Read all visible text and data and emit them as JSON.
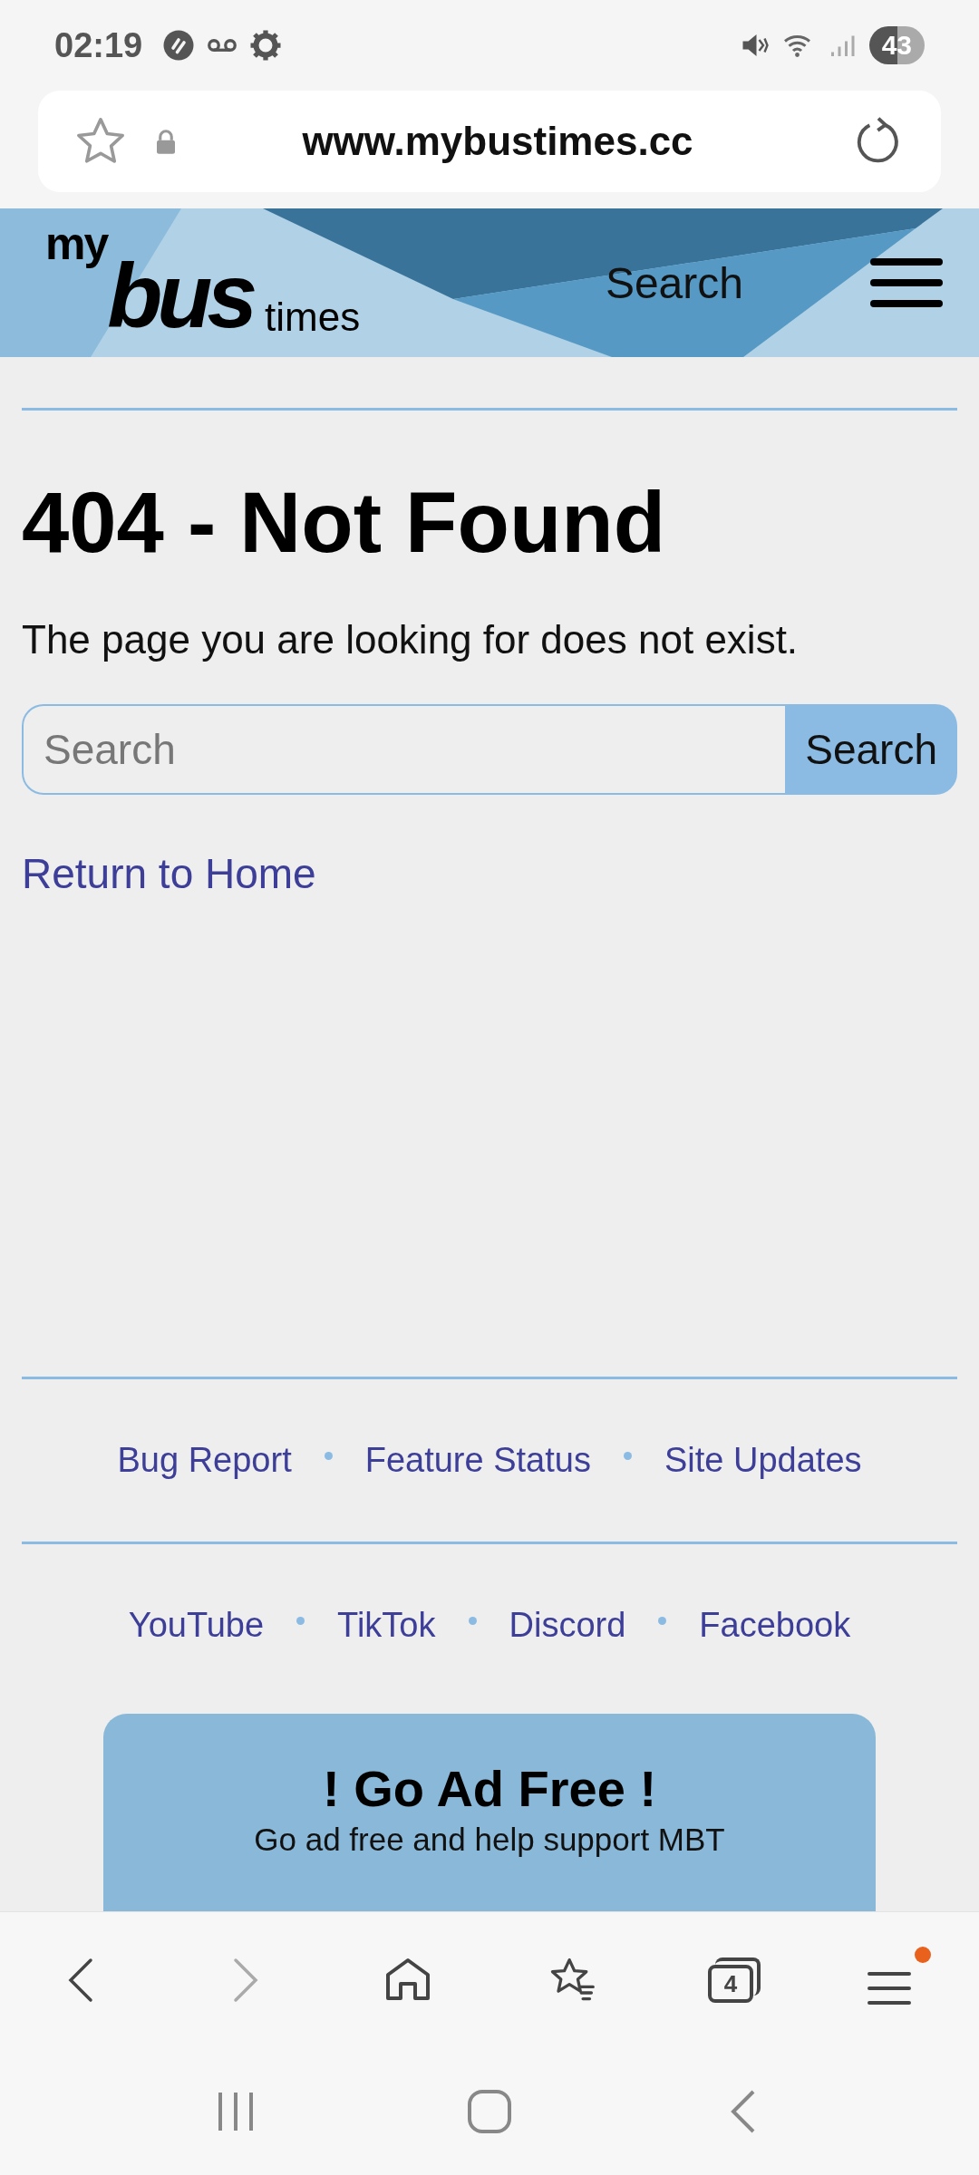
{
  "status_bar": {
    "time": "02:19",
    "battery": "43"
  },
  "address_bar": {
    "url": "www.mybustimes.cc"
  },
  "header": {
    "logo": {
      "top": "my",
      "main": "bus",
      "tail": "times"
    },
    "search_link": "Search"
  },
  "page": {
    "title": "404 - Not Found",
    "message": "The page you are looking for does not exist.",
    "search": {
      "placeholder": "Search",
      "button": "Search"
    },
    "home_link": "Return to Home"
  },
  "footer": {
    "links": [
      "Bug Report",
      "Feature Status",
      "Site Updates"
    ],
    "social": [
      "YouTube",
      "TikTok",
      "Discord",
      "Facebook"
    ]
  },
  "promo": {
    "title": "! Go Ad Free !",
    "subtitle": "Go ad free and help support MBT"
  },
  "browser_nav": [
    {
      "kind": "back",
      "disabled": false
    },
    {
      "kind": "forward",
      "disabled": true
    },
    {
      "kind": "home"
    },
    {
      "kind": "bookmarks"
    },
    {
      "kind": "tabs",
      "count": "4"
    },
    {
      "kind": "menu",
      "badge": true
    }
  ]
}
